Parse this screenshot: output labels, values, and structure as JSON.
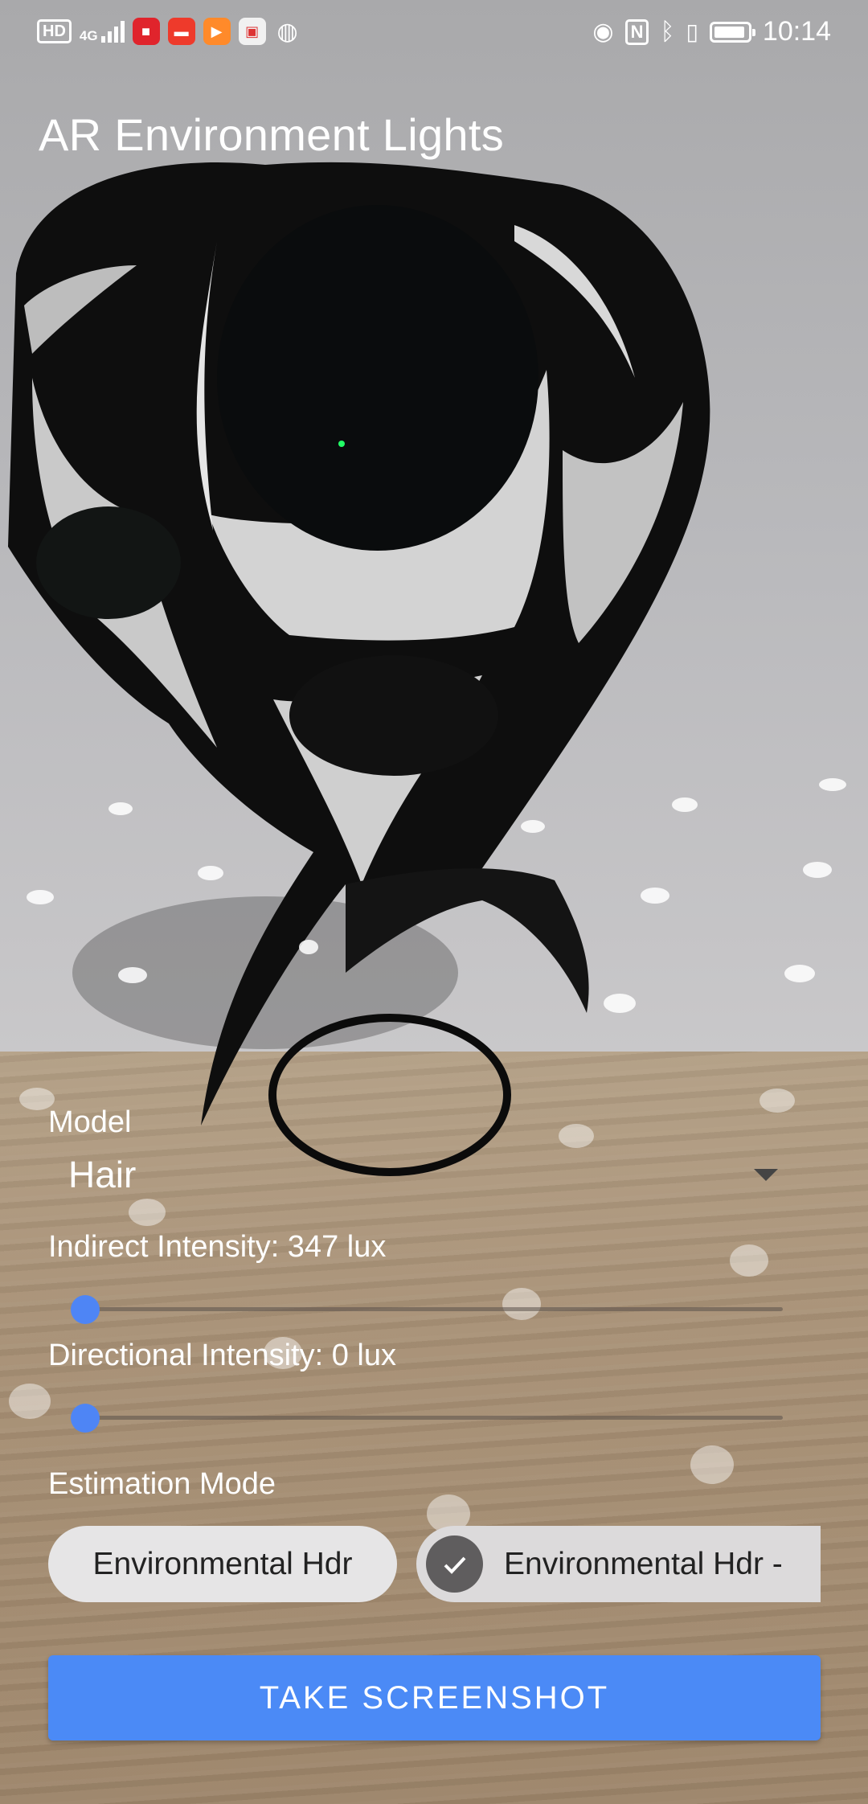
{
  "status_bar": {
    "hd_badge": "HD",
    "network": "4G",
    "time": "10:14",
    "battery_level": 0.8,
    "left_icons": [
      "hd-badge",
      "signal-4g-icon",
      "video-app-icon",
      "news-app-icon",
      "player-app-icon",
      "shop-app-icon",
      "wechat-icon"
    ],
    "right_icons": [
      "eye-comfort-icon",
      "nfc-icon",
      "bluetooth-icon",
      "vibrate-icon",
      "battery-icon"
    ]
  },
  "app": {
    "title": "AR Environment Lights"
  },
  "model": {
    "label": "Model",
    "selected": "Hair"
  },
  "indirect_intensity": {
    "label": "Indirect Intensity: 347 lux",
    "value_fraction": 0.0
  },
  "directional_intensity": {
    "label": "Directional Intensity: 0 lux",
    "value_fraction": 0.0
  },
  "estimation_mode": {
    "label": "Estimation Mode",
    "options": [
      {
        "label": "Environmental Hdr",
        "selected": false
      },
      {
        "label": "Environmental Hdr -",
        "selected": true
      }
    ]
  },
  "screenshot_button": {
    "label": "TAKE SCREENSHOT"
  },
  "colors": {
    "accent": "#4b8af6",
    "slider": "#4e85f5",
    "chip": "#e6e5e6",
    "chip_selected": "#dcdadb"
  }
}
